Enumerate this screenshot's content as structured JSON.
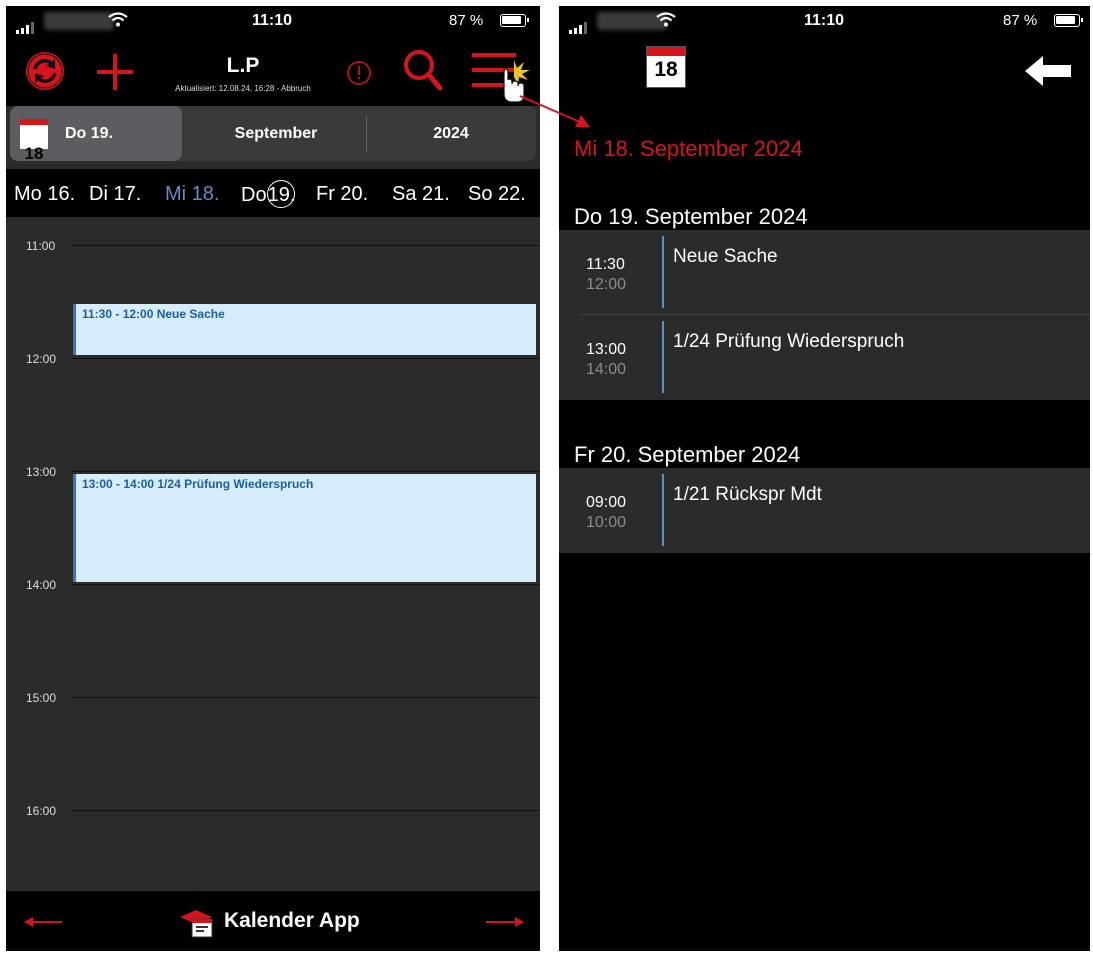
{
  "status_bar": {
    "time": "11:10",
    "battery": "87 %"
  },
  "left": {
    "header": {
      "title": "L.P",
      "subtitle": "Aktualisiert: 12.08.24, 16:28 - Abbruch",
      "icons": [
        "sync-icon",
        "plus-icon",
        "alert-icon",
        "search-icon",
        "menu-icon"
      ]
    },
    "datebar": {
      "icon_day": "18",
      "day": "Do  19.",
      "month": "September",
      "year": "2024"
    },
    "week": {
      "days": [
        "Mo 16.",
        "Di 17.",
        "Mi 18.",
        "Do",
        "19.",
        "Fr 20.",
        "Sa 21.",
        "So 22."
      ]
    },
    "timeline": {
      "hours": [
        "11:00",
        "12:00",
        "13:00",
        "14:00",
        "15:00",
        "16:00"
      ],
      "events": [
        {
          "label": "11:30 - 12:00 Neue Sache"
        },
        {
          "label": "13:00 - 14:00 1/24 Prüfung Wiederspruch"
        }
      ]
    },
    "footer": {
      "label": "Kalender App"
    }
  },
  "right": {
    "header": {
      "icon_day": "18"
    },
    "selected_date": "Mi 18. September 2024",
    "sections": [
      {
        "heading": "Do 19. September 2024",
        "items": [
          {
            "start": "11:30",
            "end": "12:00",
            "title": "Neue Sache"
          },
          {
            "start": "13:00",
            "end": "14:00",
            "title": "1/24 Prüfung Wiederspruch"
          }
        ]
      },
      {
        "heading": "Fr 20. September 2024",
        "items": [
          {
            "start": "09:00",
            "end": "10:00",
            "title": "1/21 Rückspr Mdt"
          }
        ]
      }
    ]
  },
  "colors": {
    "accent_red": "#d6141b",
    "event_blue": "#1a5fa6",
    "event_bg": "#d6ecfb",
    "today_blue": "#5e8fc7"
  }
}
